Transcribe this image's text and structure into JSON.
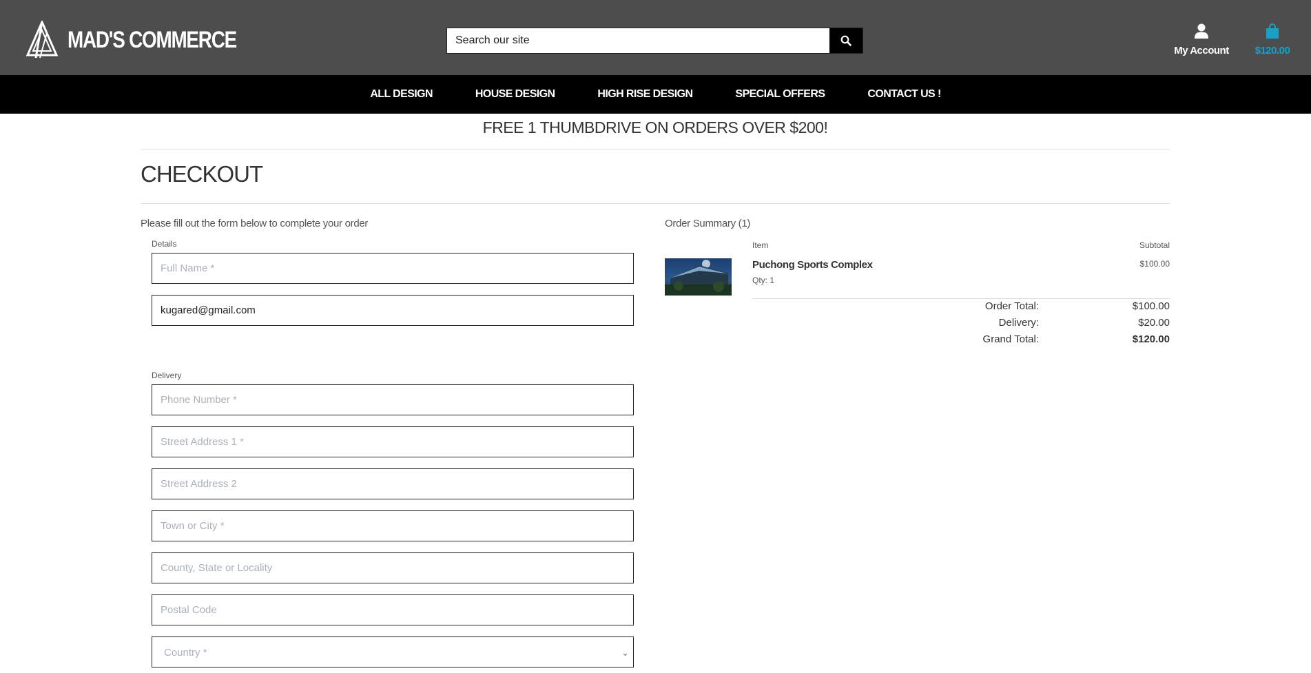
{
  "header": {
    "brand": "MAD'S COMMERCE",
    "search_placeholder": "Search our site",
    "account_label": "My Account",
    "cart_total": "$120.00"
  },
  "nav": {
    "items": [
      "ALL DESIGN",
      "HOUSE DESIGN",
      "HIGH RISE DESIGN",
      "SPECIAL OFFERS",
      "CONTACT US !"
    ]
  },
  "promo": "FREE 1 THUMBDRIVE ON ORDERS OVER $200!",
  "page_title": "CHECKOUT",
  "form": {
    "intro": "Please fill out the form below to complete your order",
    "details_label": "Details",
    "full_name_placeholder": "Full Name *",
    "email_value": "kugared@gmail.com",
    "delivery_label": "Delivery",
    "phone_placeholder": "Phone Number *",
    "street1_placeholder": "Street Address 1 *",
    "street2_placeholder": "Street Address 2",
    "town_placeholder": "Town or City *",
    "county_placeholder": "County, State or Locality",
    "postal_placeholder": "Postal Code",
    "country_placeholder": "Country *"
  },
  "summary": {
    "title": "Order Summary (1)",
    "item_header": "Item",
    "subtotal_header": "Subtotal",
    "item_name": "Puchong Sports Complex",
    "item_qty": "Qty: 1",
    "item_subtotal": "$100.00",
    "order_total_label": "Order Total:",
    "order_total": "$100.00",
    "delivery_label": "Delivery:",
    "delivery": "$20.00",
    "grand_total_label": "Grand Total:",
    "grand_total": "$120.00"
  },
  "colors": {
    "header_bg": "#4d4d4d",
    "nav_bg": "#000000",
    "cart_accent": "#18a0c8"
  }
}
